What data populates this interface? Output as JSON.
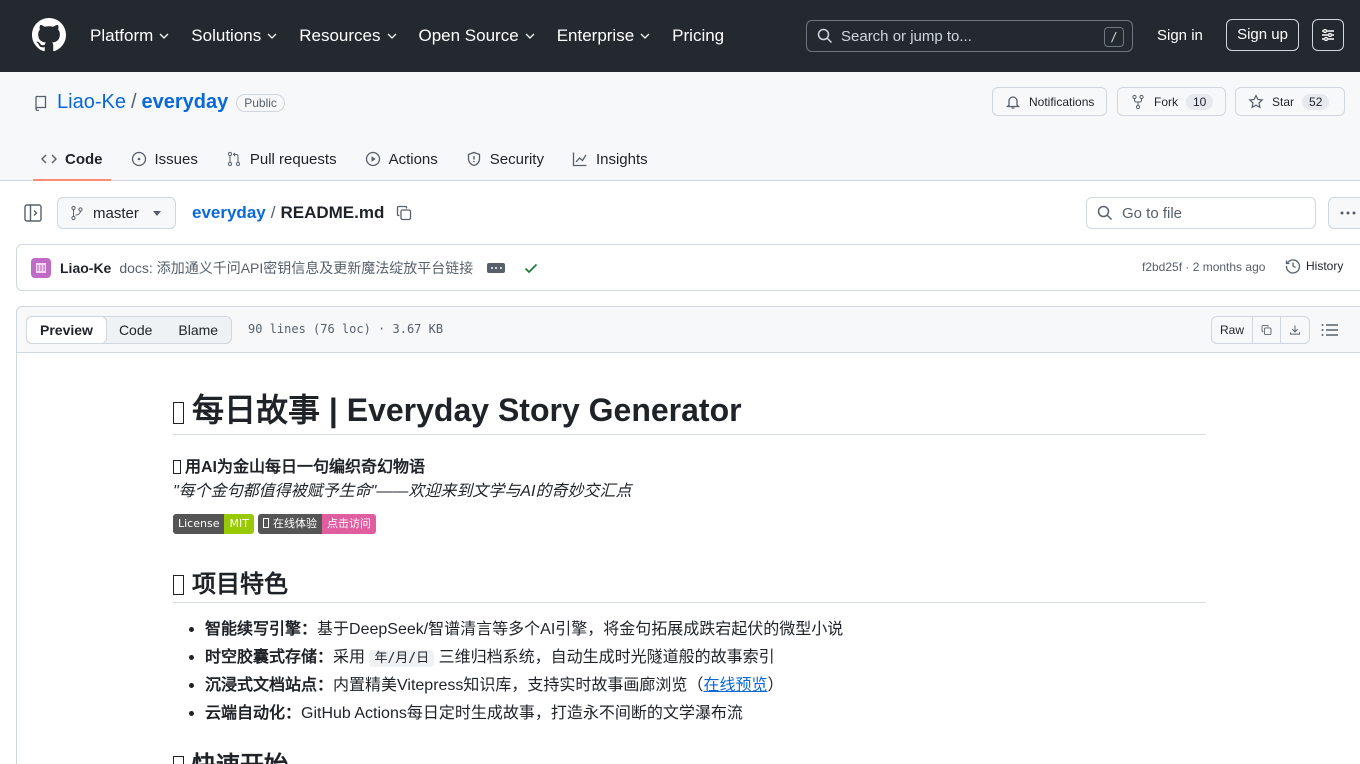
{
  "header": {
    "nav": [
      "Platform",
      "Solutions",
      "Resources",
      "Open Source",
      "Enterprise",
      "Pricing"
    ],
    "search_placeholder": "Search or jump to...",
    "search_shortcut": "/",
    "sign_in": "Sign in",
    "sign_up": "Sign up"
  },
  "repo": {
    "owner": "Liao-Ke",
    "separator": "/",
    "name": "everyday",
    "visibility": "Public",
    "notifications_label": "Notifications",
    "fork_label": "Fork",
    "fork_count": "10",
    "star_label": "Star",
    "star_count": "52",
    "tabs": [
      "Code",
      "Issues",
      "Pull requests",
      "Actions",
      "Security",
      "Insights"
    ]
  },
  "file": {
    "branch": "master",
    "dir": "everyday",
    "sep": "/",
    "name": "README.md",
    "goto_placeholder": "Go to file"
  },
  "commit": {
    "author": "Liao-Ke",
    "message": "docs: 添加通义千问API密钥信息及更新魔法绽放平台链接",
    "meta": "f2bd25f · 2 months ago",
    "history": "History"
  },
  "viewer": {
    "modes": [
      "Preview",
      "Code",
      "Blame"
    ],
    "info": "90 lines (76 loc) · 3.67 KB",
    "raw": "Raw"
  },
  "readme": {
    "title": "每日故事 | Everyday Story Generator",
    "tagline": "用AI为金山每日一句编织奇幻物语",
    "quote": "\"每个金句都值得被赋予生命\"——欢迎来到文学与AI的奇妙交汇点",
    "badges": [
      {
        "left": "License",
        "right": "MIT",
        "color": "#97ca00"
      },
      {
        "left": "在线体验",
        "right": "点击访问",
        "color": "#e05d9f"
      }
    ],
    "features_heading": "项目特色",
    "features": [
      {
        "bold": "智能续写引擎：",
        "text": "基于DeepSeek/智谱清言等多个AI引擎，将金句拓展成跌宕起伏的微型小说"
      },
      {
        "bold": "时空胶囊式存储：",
        "pre": "采用 ",
        "code": "年/月/日",
        "text": " 三维归档系统，自动生成时光隧道般的故事索引"
      },
      {
        "bold": "沉浸式文档站点：",
        "text": "内置精美Vitepress知识库，支持实时故事画廊浏览（",
        "link": "在线预览",
        "post": "）"
      },
      {
        "bold": "云端自动化：",
        "text": "GitHub Actions每日定时生成故事，打造永不间断的文学瀑布流"
      }
    ],
    "quickstart_heading": "快速开始"
  }
}
